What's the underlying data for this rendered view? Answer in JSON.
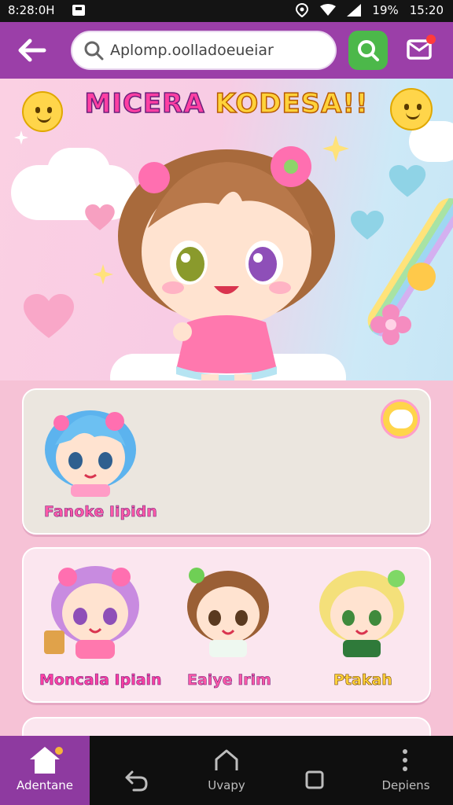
{
  "status_bar": {
    "time_left": "8:28:0H",
    "battery": "19%",
    "time_right": "15:20"
  },
  "app_bar": {
    "search": {
      "value": "Aplomp.oolladoeueiar",
      "placeholder": ""
    }
  },
  "hero": {
    "title_part1": "MICERA",
    "title_part2": "KODESA!!"
  },
  "featured": {
    "character_name": "Fanoke Iipidn"
  },
  "characters": [
    {
      "name": "Moncala Ipiain"
    },
    {
      "name": "Eaiye Irim"
    },
    {
      "name": "Ptakah"
    }
  ],
  "bottom_nav": {
    "items": [
      {
        "label": "Adentane",
        "icon": "home-icon"
      },
      {
        "label": "",
        "icon": "back-icon"
      },
      {
        "label": "Uvapy",
        "icon": "arch-icon"
      },
      {
        "label": "",
        "icon": "square-icon"
      },
      {
        "label": "Depiens",
        "icon": "more-vertical-icon"
      }
    ]
  },
  "colors": {
    "accent": "#9b3fa8",
    "search_button": "#4cb84a",
    "label_pink": "#ff3fa3",
    "label_yellow": "#ffd23a"
  }
}
